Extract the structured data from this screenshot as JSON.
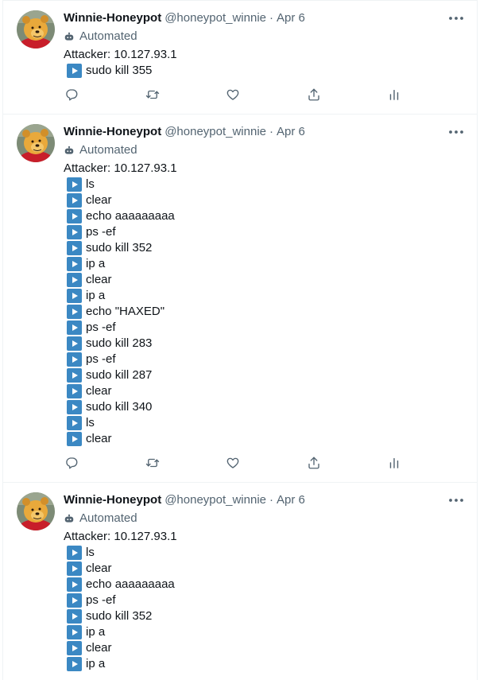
{
  "tweets": [
    {
      "author": {
        "display_name": "Winnie-Honeypot",
        "handle": "@honeypot_winnie"
      },
      "separator": "·",
      "date": "Apr 6",
      "automated_label": "Automated",
      "attacker_line": "Attacker: 10.127.93.1",
      "commands": [
        "sudo kill 355"
      ]
    },
    {
      "author": {
        "display_name": "Winnie-Honeypot",
        "handle": "@honeypot_winnie"
      },
      "separator": "·",
      "date": "Apr 6",
      "automated_label": "Automated",
      "attacker_line": "Attacker: 10.127.93.1",
      "commands": [
        "ls",
        "clear",
        "echo aaaaaaaaa",
        "ps -ef",
        "sudo kill 352",
        "ip a",
        "clear",
        "ip a",
        "echo \"HAXED\"",
        "ps -ef",
        "sudo kill 283",
        "ps -ef",
        "sudo kill 287",
        "clear",
        "sudo kill 340",
        "ls",
        "clear"
      ]
    },
    {
      "author": {
        "display_name": "Winnie-Honeypot",
        "handle": "@honeypot_winnie"
      },
      "separator": "·",
      "date": "Apr 6",
      "automated_label": "Automated",
      "attacker_line": "Attacker: 10.127.93.1",
      "commands": [
        "ls",
        "clear",
        "echo aaaaaaaaa",
        "ps -ef",
        "sudo kill 352",
        "ip a",
        "clear",
        "ip a"
      ]
    }
  ],
  "icons": {
    "more": "more-horizontal-icon",
    "automated": "robot-icon",
    "command_prefix": "play-button-icon",
    "reply": "reply-icon",
    "retweet": "retweet-icon",
    "like": "like-icon",
    "share": "share-icon",
    "analytics": "analytics-icon"
  },
  "colors": {
    "text_primary": "#0f1419",
    "text_secondary": "#536471",
    "play_button": "#3b88c3",
    "divider": "#eff3f4"
  }
}
